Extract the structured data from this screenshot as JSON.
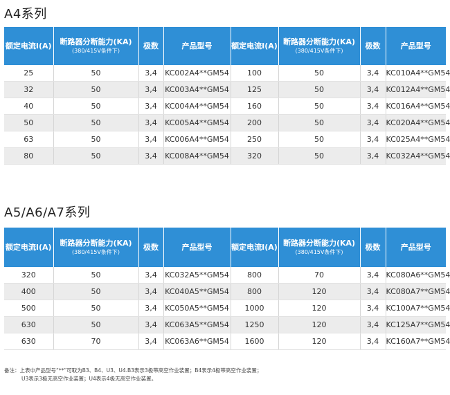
{
  "sections": [
    {
      "title": "A4系列",
      "headers": {
        "current": "额定电流I(A)",
        "breaking": "断路器分断能力(KA)",
        "breaking_sub": "(380/415V条件下)",
        "poles": "极数",
        "model": "产品型号"
      },
      "rows": [
        [
          "25",
          "50",
          "3,4",
          "KC002A4**GM54",
          "100",
          "50",
          "3,4",
          "KC010A4**GM54"
        ],
        [
          "32",
          "50",
          "3,4",
          "KC003A4**GM54",
          "125",
          "50",
          "3,4",
          "KC012A4**GM54"
        ],
        [
          "40",
          "50",
          "3,4",
          "KC004A4**GM54",
          "160",
          "50",
          "3,4",
          "KC016A4**GM54"
        ],
        [
          "50",
          "50",
          "3,4",
          "KC005A4**GM54",
          "200",
          "50",
          "3,4",
          "KC020A4**GM54"
        ],
        [
          "63",
          "50",
          "3,4",
          "KC006A4**GM54",
          "250",
          "50",
          "3,4",
          "KC025A4**GM54"
        ],
        [
          "80",
          "50",
          "3,4",
          "KC008A4**GM54",
          "320",
          "50",
          "3,4",
          "KC032A4**GM54"
        ]
      ]
    },
    {
      "title": "A5/A6/A7系列",
      "headers": {
        "current": "额定电流I(A)",
        "breaking": "断路器分断能力(KA)",
        "breaking_sub": "(380/415V条件下)",
        "poles": "极数",
        "model": "产品型号"
      },
      "rows": [
        [
          "320",
          "50",
          "3,4",
          "KC032A5**GM54",
          "800",
          "70",
          "3,4",
          "KC080A6**GM54"
        ],
        [
          "400",
          "50",
          "3,4",
          "KC040A5**GM54",
          "800",
          "120",
          "3,4",
          "KC080A7**GM54"
        ],
        [
          "500",
          "50",
          "3,4",
          "KC050A5**GM54",
          "1000",
          "120",
          "3,4",
          "KC100A7**GM54"
        ],
        [
          "630",
          "50",
          "3,4",
          "KC063A5**GM54",
          "1250",
          "120",
          "3,4",
          "KC125A7**GM54"
        ],
        [
          "630",
          "70",
          "3,4",
          "KC063A6**GM54",
          "1600",
          "120",
          "3,4",
          "KC160A7**GM54"
        ]
      ]
    }
  ],
  "note": {
    "line1": "备注：上表中产品型号“**”可取为B3、B4、U3、U4.B3表示3极带高空作业装置；B4表示4极带高空作业装置；",
    "line2": "U3表示3极无高空作业装置；U4表示4极无高空作业装置。"
  },
  "colors": {
    "header_bg": "#2f8fd6",
    "alt_row": "#ececec"
  }
}
